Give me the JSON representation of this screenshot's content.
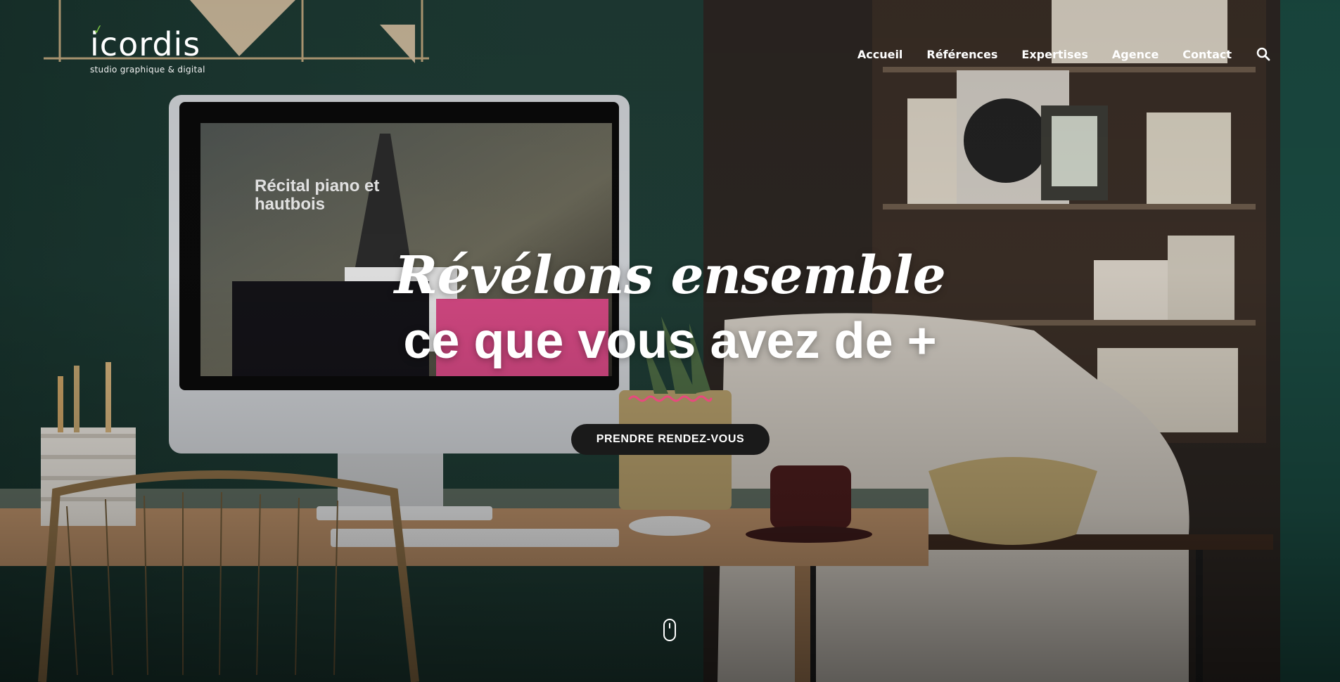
{
  "brand": {
    "name": "icordis",
    "tagline": "studio graphique & digital"
  },
  "nav": {
    "items": [
      "Accueil",
      "Références",
      "Expertises",
      "Agence",
      "Contact"
    ]
  },
  "hero": {
    "line1": "Révélons ensemble",
    "line2": "ce que vous avez de +",
    "cta_label": "PRENDRE RENDEZ-VOUS"
  },
  "screen": {
    "title_line1": "Récital piano et",
    "title_line2": "hautbois"
  },
  "icons": {
    "search": "search-icon",
    "scroll": "mouse-scroll-icon"
  },
  "colors": {
    "accent_pink": "#e8497e",
    "logo_green": "#7ac143",
    "cta_bg": "#1a1a1a"
  }
}
